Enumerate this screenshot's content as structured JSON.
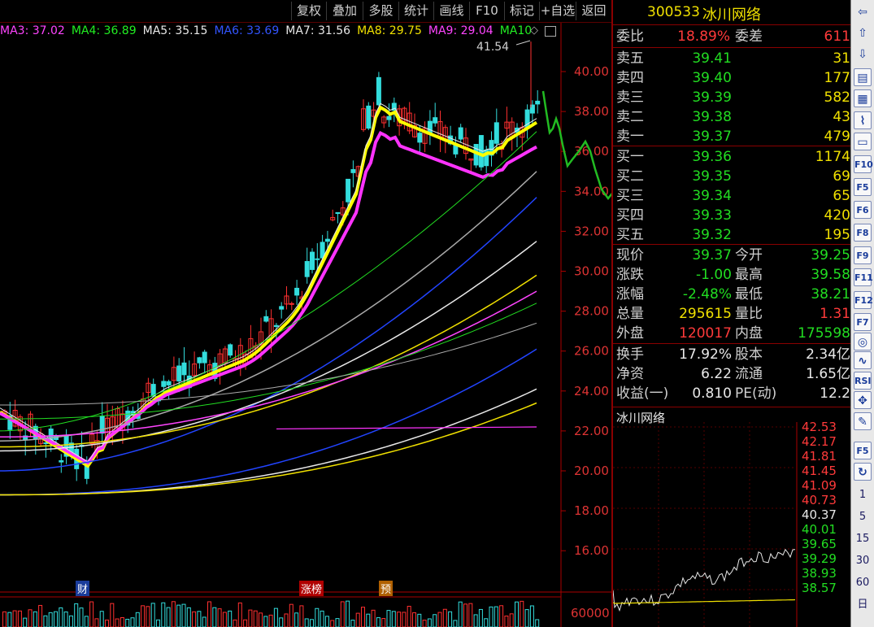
{
  "toolbar": {
    "buttons": [
      "复权",
      "叠加",
      "多股",
      "统计",
      "画线",
      "F10",
      "标记",
      "+自选",
      "返回"
    ]
  },
  "ma_legend": [
    {
      "label": "MA3: 37.02",
      "color": "#ff44ff"
    },
    {
      "label": "MA4: 36.89",
      "color": "#22ee22"
    },
    {
      "label": "MA5: 35.15",
      "color": "#e8e8e8"
    },
    {
      "label": "MA6: 33.69",
      "color": "#3355ff"
    },
    {
      "label": "MA7: 31.56",
      "color": "#e8e8e8"
    },
    {
      "label": "MA8: 29.75",
      "color": "#f0e000"
    },
    {
      "label": "MA9: 29.04",
      "color": "#ff44ff"
    },
    {
      "label": "MA10",
      "color": "#22ee22"
    }
  ],
  "chart": {
    "high_marker": "41.54",
    "y_axis": [
      "40.00",
      "38.00",
      "36.00",
      "34.00",
      "32.00",
      "30.00",
      "28.00",
      "26.00",
      "24.00",
      "22.00",
      "20.00",
      "18.00",
      "16.00"
    ],
    "volume_axis": "60000",
    "event_tags": [
      "财",
      "涨榜",
      "预"
    ]
  },
  "quote": {
    "code": "300533",
    "name": "冰川网络",
    "weibi": {
      "label": "委比",
      "value": "18.89%",
      "label2": "委差",
      "value2": "611"
    },
    "asks": [
      {
        "label": "卖五",
        "price": "39.41",
        "vol": "31"
      },
      {
        "label": "卖四",
        "price": "39.40",
        "vol": "177"
      },
      {
        "label": "卖三",
        "price": "39.39",
        "vol": "582"
      },
      {
        "label": "卖二",
        "price": "39.38",
        "vol": "43"
      },
      {
        "label": "卖一",
        "price": "39.37",
        "vol": "479"
      }
    ],
    "bids": [
      {
        "label": "买一",
        "price": "39.36",
        "vol": "1174"
      },
      {
        "label": "买二",
        "price": "39.35",
        "vol": "69"
      },
      {
        "label": "买三",
        "price": "39.34",
        "vol": "65"
      },
      {
        "label": "买四",
        "price": "39.33",
        "vol": "420"
      },
      {
        "label": "买五",
        "price": "39.32",
        "vol": "195"
      }
    ],
    "stats1": [
      {
        "l1": "现价",
        "v1": "39.37",
        "c1": "green",
        "l2": "今开",
        "v2": "39.25",
        "c2": "green"
      },
      {
        "l1": "涨跌",
        "v1": "-1.00",
        "c1": "green",
        "l2": "最高",
        "v2": "39.58",
        "c2": "green"
      },
      {
        "l1": "涨幅",
        "v1": "-2.48%",
        "c1": "green",
        "l2": "最低",
        "v2": "38.21",
        "c2": "green"
      },
      {
        "l1": "总量",
        "v1": "295615",
        "c1": "yellow",
        "l2": "量比",
        "v2": "1.31",
        "c2": "red"
      },
      {
        "l1": "外盘",
        "v1": "120017",
        "c1": "red",
        "l2": "内盘",
        "v2": "175598",
        "c2": "green"
      }
    ],
    "stats2": [
      {
        "l1": "换手",
        "v1": "17.92%",
        "l2": "股本",
        "v2": "2.34亿"
      },
      {
        "l1": "净资",
        "v1": "6.22",
        "l2": "流通",
        "v2": "1.65亿"
      },
      {
        "l1": "收益(一)",
        "v1": "0.810",
        "l2": "PE(动)",
        "v2": "12.2"
      }
    ]
  },
  "intraday": {
    "title": "冰川网络",
    "labels": [
      {
        "text": "42.53",
        "c": "red"
      },
      {
        "text": "42.17",
        "c": "red"
      },
      {
        "text": "41.81",
        "c": "red"
      },
      {
        "text": "41.45",
        "c": "red"
      },
      {
        "text": "41.09",
        "c": "red"
      },
      {
        "text": "40.73",
        "c": "red"
      },
      {
        "text": "40.37",
        "c": "white"
      },
      {
        "text": "40.01",
        "c": "green"
      },
      {
        "text": "39.65",
        "c": "green"
      },
      {
        "text": "39.29",
        "c": "green"
      },
      {
        "text": "38.93",
        "c": "green"
      },
      {
        "text": "38.57",
        "c": "green"
      }
    ]
  },
  "right_tools": {
    "icons": [
      "arrow-left-icon",
      "arrow-up-icon",
      "arrow-down-icon",
      "kline-icon",
      "quote-list-icon",
      "chart-icon",
      "window-icon",
      "f10-icon",
      "f5-icon",
      "f6-icon",
      "f8-icon",
      "f9-icon",
      "f11-icon",
      "f12-icon",
      "f7-icon",
      "circle-icon",
      "wave-icon",
      "rsi-icon",
      "multi-arrow-icon",
      "pencil-icon",
      "f5b-icon",
      "refresh-icon"
    ],
    "periods": [
      "1",
      "5",
      "15",
      "30",
      "60",
      "日"
    ]
  }
}
